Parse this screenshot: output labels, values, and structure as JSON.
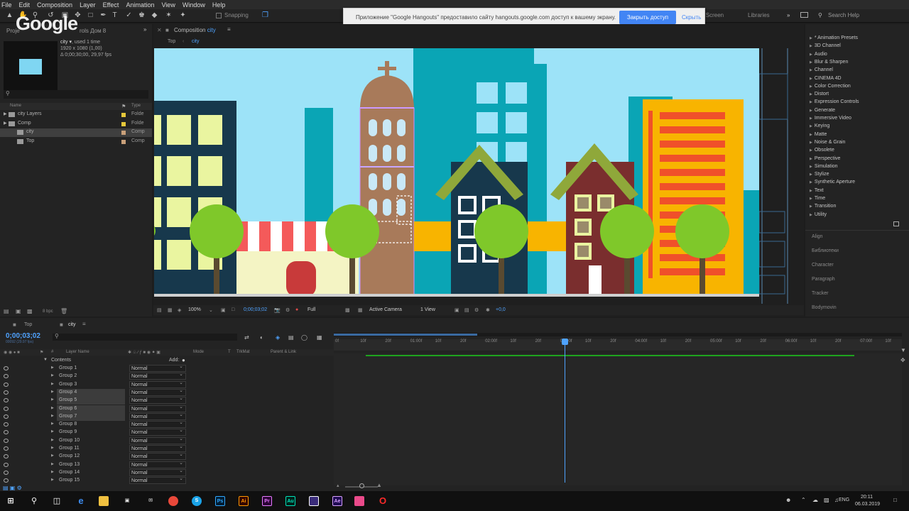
{
  "menu": [
    "File",
    "Edit",
    "Composition",
    "Layer",
    "Effect",
    "Animation",
    "View",
    "Window",
    "Help"
  ],
  "toolbar": {
    "snapping": "Snapping",
    "fullscreen_tab": "ll Screen",
    "libraries_tab": "Libraries",
    "search_help": "Search Help"
  },
  "overlay_logo": "Google",
  "notification": {
    "message": "Приложение \"Google Hangouts\" предоставило сайту hangouts.google.com доступ к вашему экрану.",
    "share_button": "Закрыть доступ",
    "hide_link": "Скрыть"
  },
  "project": {
    "tab": "Proje",
    "tab2": "rols Дом 8",
    "comp_name": "city ▾",
    "used": ", used 1 time",
    "resolution": "1920 x 1080 (1,00)",
    "duration": "Δ 0;00;30;00, 29,97 fps",
    "col_name": "Name",
    "col_type": "Type",
    "items": [
      {
        "name": "city Layers",
        "type": "Folde",
        "color": "#e6c83a",
        "kind": "folder"
      },
      {
        "name": "Comp",
        "type": "Folde",
        "color": "#e6c83a",
        "kind": "folder"
      },
      {
        "name": "city",
        "type": "Comp",
        "color": "#c9a07a",
        "kind": "comp"
      },
      {
        "name": "Top",
        "type": "Comp",
        "color": "#c9a07a",
        "kind": "comp"
      }
    ],
    "bpc": "8 bpc"
  },
  "composition": {
    "tab_label": "Composition",
    "tab_comp": "city",
    "crumb1": "Top",
    "crumb2": "city",
    "zoom": "100%",
    "timecode": "0;00;03;02",
    "resolution": "Full",
    "camera": "Active Camera",
    "view": "1 View",
    "offset": "+0,0"
  },
  "effects": {
    "items": [
      "* Animation Presets",
      "3D Channel",
      "Audio",
      "Blur & Sharpen",
      "Channel",
      "CINEMA 4D",
      "Color Correction",
      "Distort",
      "Expression Controls",
      "Generate",
      "Immersive Video",
      "Keying",
      "Matte",
      "Noise & Grain",
      "Obsolete",
      "Perspective",
      "Simulation",
      "Stylize",
      "Synthetic Aperture",
      "Text",
      "Time",
      "Transition",
      "Utility"
    ],
    "panels": [
      "Align",
      "Библиотеки",
      "Character",
      "Paragraph",
      "Tracker",
      "Bodymovin"
    ]
  },
  "timeline": {
    "tab1": "Top",
    "tab2": "city",
    "current_time": "0;00;03;02",
    "frame_info": "00092 (29.97 fps)",
    "col_layer": "Layer Name",
    "col_mode": "Mode",
    "col_t": "T",
    "col_trkmat": "TrkMat",
    "col_parent": "Parent & Link",
    "contents_label": "Contents",
    "add_label": "Add:",
    "layers": [
      {
        "name": "Group 1",
        "mode": "Normal",
        "selected": false
      },
      {
        "name": "Group 2",
        "mode": "Normal",
        "selected": false
      },
      {
        "name": "Group 3",
        "mode": "Normal",
        "selected": false
      },
      {
        "name": "Group 4",
        "mode": "Normal",
        "selected": true
      },
      {
        "name": "Group 5",
        "mode": "Normal",
        "selected": true
      },
      {
        "name": "Group 6",
        "mode": "Normal",
        "selected": true
      },
      {
        "name": "Group 7",
        "mode": "Normal",
        "selected": true
      },
      {
        "name": "Group 8",
        "mode": "Normal",
        "selected": false
      },
      {
        "name": "Group 9",
        "mode": "Normal",
        "selected": false
      },
      {
        "name": "Group 10",
        "mode": "Normal",
        "selected": false
      },
      {
        "name": "Group 11",
        "mode": "Normal",
        "selected": false
      },
      {
        "name": "Group 12",
        "mode": "Normal",
        "selected": false
      },
      {
        "name": "Group 13",
        "mode": "Normal",
        "selected": false
      },
      {
        "name": "Group 14",
        "mode": "Normal",
        "selected": false
      },
      {
        "name": "Group 15",
        "mode": "Normal",
        "selected": false
      }
    ],
    "ruler_labels": [
      "0f",
      "10f",
      "20f",
      "01:00f",
      "10f",
      "20f",
      "02:00f",
      "10f",
      "20f",
      "03:00f",
      "10f",
      "20f",
      "04:00f",
      "10f",
      "20f",
      "05:00f",
      "10f",
      "20f",
      "06:00f",
      "10f",
      "20f",
      "07:00f",
      "10f"
    ]
  },
  "taskbar": {
    "lang": "ENG",
    "time": "20:11",
    "date": "06.03.2019",
    "apps": [
      {
        "label": "Ps",
        "bg": "#001d34",
        "fg": "#31a8ff"
      },
      {
        "label": "Ai",
        "bg": "#330000",
        "fg": "#ff9a00"
      },
      {
        "label": "Pr",
        "bg": "#2a0034",
        "fg": "#e77bff"
      },
      {
        "label": "Au",
        "bg": "#00211a",
        "fg": "#00e4bb"
      },
      {
        "label": "",
        "bg": "#3a2c7a",
        "fg": "#ffffff"
      },
      {
        "label": "Ae",
        "bg": "#1f0b52",
        "fg": "#d8a0ff"
      }
    ]
  },
  "colors": {
    "accent_blue": "#4fa3ff",
    "sky": "#9de3f8",
    "teal_building": "#0aa5b5",
    "dark_navy": "#17384c",
    "tree_green": "#7fc82a",
    "yellow_building": "#f8b400",
    "red_orange": "#f0502a"
  }
}
